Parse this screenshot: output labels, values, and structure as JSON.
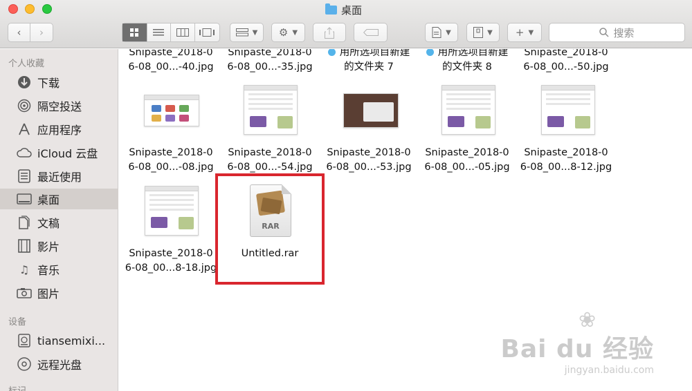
{
  "window": {
    "title": "桌面",
    "search_placeholder": "搜索"
  },
  "sidebar": {
    "favorites_header": "个人收藏",
    "devices_header": "设备",
    "tags_header": "标记",
    "favorites": [
      {
        "label": "下载",
        "icon": "download-icon"
      },
      {
        "label": "隔空投送",
        "icon": "airdrop-icon"
      },
      {
        "label": "应用程序",
        "icon": "applications-icon"
      },
      {
        "label": "iCloud 云盘",
        "icon": "icloud-icon"
      },
      {
        "label": "最近使用",
        "icon": "recents-icon"
      },
      {
        "label": "桌面",
        "icon": "desktop-icon",
        "selected": true
      },
      {
        "label": "文稿",
        "icon": "documents-icon"
      },
      {
        "label": "影片",
        "icon": "movies-icon"
      },
      {
        "label": "音乐",
        "icon": "music-icon"
      },
      {
        "label": "图片",
        "icon": "pictures-icon"
      }
    ],
    "devices": [
      {
        "label": "tiansemixi...",
        "icon": "disk-icon"
      },
      {
        "label": "远程光盘",
        "icon": "optical-disc-icon"
      }
    ]
  },
  "files": {
    "row0": [
      {
        "line1": "Snipaste_2018-0",
        "line2": "6-08_00...-40.jpg"
      },
      {
        "line1": "Snipaste_2018-0",
        "line2": "6-08_00...-35.jpg"
      },
      {
        "line1": "用所选项目新建",
        "line2": "的文件夹 7",
        "tagged": true
      },
      {
        "line1": "用所选项目新建",
        "line2": "的文件夹 8",
        "tagged": true
      },
      {
        "line1": "Snipaste_2018-0",
        "line2": "6-08_00...-50.jpg"
      }
    ],
    "row1": [
      {
        "line1": "Snipaste_2018-0",
        "line2": "6-08_00...-08.jpg"
      },
      {
        "line1": "Snipaste_2018-0",
        "line2": "6-08_00...-54.jpg"
      },
      {
        "line1": "Snipaste_2018-0",
        "line2": "6-08_00...-53.jpg"
      },
      {
        "line1": "Snipaste_2018-0",
        "line2": "6-08_00...-05.jpg"
      },
      {
        "line1": "Snipaste_2018-0",
        "line2": "6-08_00...8-12.jpg"
      }
    ],
    "row2": [
      {
        "line1": "Snipaste_2018-0",
        "line2": "6-08_00...8-18.jpg"
      },
      {
        "line1": "Untitled.rar",
        "line2": "",
        "archive_label": "RAR",
        "highlighted": true
      }
    ]
  },
  "watermark": {
    "brand": "Bai du 经验",
    "url": "jingyan.baidu.com"
  },
  "colors": {
    "highlight": "#d9262e",
    "tag_blue": "#54b4ea",
    "sidebar_bg": "#e9e5e4"
  }
}
